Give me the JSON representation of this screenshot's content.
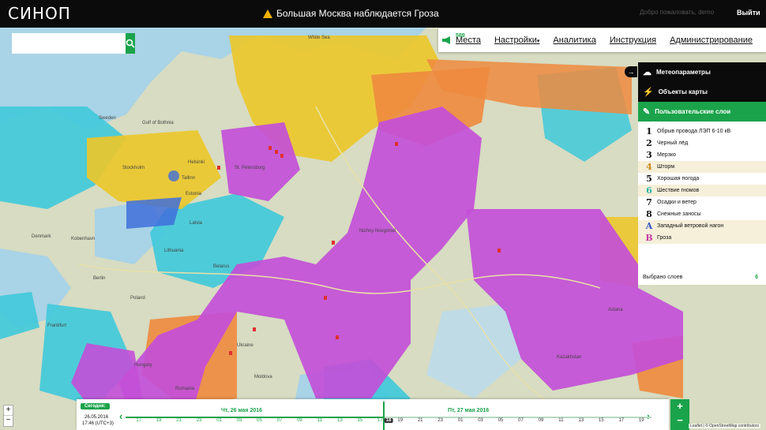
{
  "topbar": {
    "logo": "СИНОП",
    "alert": "Большая Москва наблюдается Гроза",
    "welcome": "Добро пожаловать, demo",
    "logout": "Выйти"
  },
  "search": {
    "placeholder": ""
  },
  "nav": {
    "notification_count": "589",
    "items": [
      "Места",
      "Настройки",
      "Аналитика",
      "Инструкция",
      "Администрирование"
    ]
  },
  "side_panel": {
    "meteo_label": "Метеопараметры",
    "objects_label": "Объекты карты",
    "user_layers_label": "Пользовательские слои",
    "layers": [
      {
        "num": "1",
        "label": "Обрыв провода ЛЭП 6-10 кВ",
        "color": "#111111"
      },
      {
        "num": "2",
        "label": "Черный лёд",
        "color": "#111111"
      },
      {
        "num": "3",
        "label": "Мерзко",
        "color": "#111111"
      },
      {
        "num": "4",
        "label": "Шторм",
        "color": "#c9851a"
      },
      {
        "num": "5",
        "label": "Хорошая погода",
        "color": "#111111"
      },
      {
        "num": "6",
        "label": "Шествие гномов",
        "color": "#2ab5a5"
      },
      {
        "num": "7",
        "label": "Осадки и ветер",
        "color": "#111111"
      },
      {
        "num": "8",
        "label": "Снежные заносы",
        "color": "#111111"
      },
      {
        "num": "А",
        "label": "Западный ветровой нагон",
        "color": "#2a4fc9"
      },
      {
        "num": "В",
        "label": "Гроза",
        "color": "#c93aa6"
      }
    ],
    "footer_label": "Выбрано слоев",
    "footer_count": "6"
  },
  "zoom": {
    "plus": "+",
    "minus": "−"
  },
  "timeline": {
    "today_label": "Сегодня:",
    "date": "26.05.2016",
    "time": "17:46 (UTC+3)",
    "day1": "Чт, 26 мая 2016",
    "day2": "Пт, 27 мая 2016",
    "hours": [
      "17",
      "19",
      "21",
      "23",
      "01",
      "03",
      "05",
      "07",
      "09",
      "11",
      "13",
      "15",
      "17",
      "19",
      "21",
      "23",
      "01",
      "03",
      "05",
      "07",
      "09",
      "11",
      "13",
      "15",
      "17",
      "19"
    ],
    "current_hour": "18",
    "zoom_plus": "+",
    "zoom_minus": "−"
  },
  "attribution": "Leaflet | © OpenStreetMap contributors",
  "map_labels": [
    "Sweden",
    "Gulf of Bothnia",
    "Stockholm",
    "Helsinki",
    "Tallinn",
    "St. Petersburg",
    "Estonia",
    "Latvia",
    "Lithuania",
    "Belarus",
    "Denmark",
    "Poland",
    "Berlin",
    "Kobenhavn",
    "Ukraine",
    "Romania",
    "Kazakhstan",
    "Hungary",
    "Frankfurt",
    "Nizhny Novgorod",
    "White Sea",
    "Moldova",
    "Astana"
  ],
  "colors": {
    "accent": "#1aa34a",
    "purple": "#c34fd8",
    "cyan": "#3fc9da",
    "yellow": "#ecc72d",
    "orange": "#ee8a3e",
    "blue": "#3f6fdb"
  }
}
